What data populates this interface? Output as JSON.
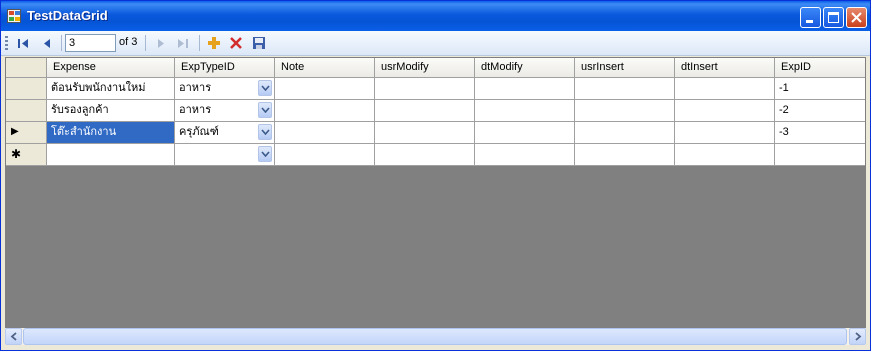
{
  "window": {
    "title": "TestDataGrid"
  },
  "navigator": {
    "position": "3",
    "count_label": "of 3"
  },
  "grid": {
    "columns": [
      "Expense",
      "ExpTypeID",
      "Note",
      "usrModify",
      "dtModify",
      "usrInsert",
      "dtInsert",
      "ExpID"
    ],
    "rows": [
      {
        "expense": "ต้อนรับพนักงานใหม่",
        "exp_type": "อาหาร",
        "note": "",
        "usr_modify": "",
        "dt_modify": "",
        "usr_insert": "",
        "dt_insert": "",
        "exp_id": "-1"
      },
      {
        "expense": "รับรองลูกค้า",
        "exp_type": "อาหาร",
        "note": "",
        "usr_modify": "",
        "dt_modify": "",
        "usr_insert": "",
        "dt_insert": "",
        "exp_id": "-2"
      },
      {
        "expense": "โต๊ะสำนักงาน",
        "exp_type": "ครุภัณฑ์",
        "note": "",
        "usr_modify": "",
        "dt_modify": "",
        "usr_insert": "",
        "dt_insert": "",
        "exp_id": "-3"
      }
    ],
    "current_row_index": 2,
    "new_row_marker": "✱",
    "current_row_marker": "▶"
  },
  "colors": {
    "title_bar": "#0a5fe8",
    "selection": "#316ac5",
    "grid_background": "#808080",
    "delete_red": "#d22c2c",
    "add_orange": "#e6a21d"
  },
  "icons": [
    "move-first-icon",
    "move-previous-icon",
    "move-next-icon",
    "move-last-icon",
    "add-new-icon",
    "delete-icon",
    "save-icon",
    "dropdown-arrow-icon",
    "scroll-left-icon",
    "scroll-right-icon"
  ]
}
